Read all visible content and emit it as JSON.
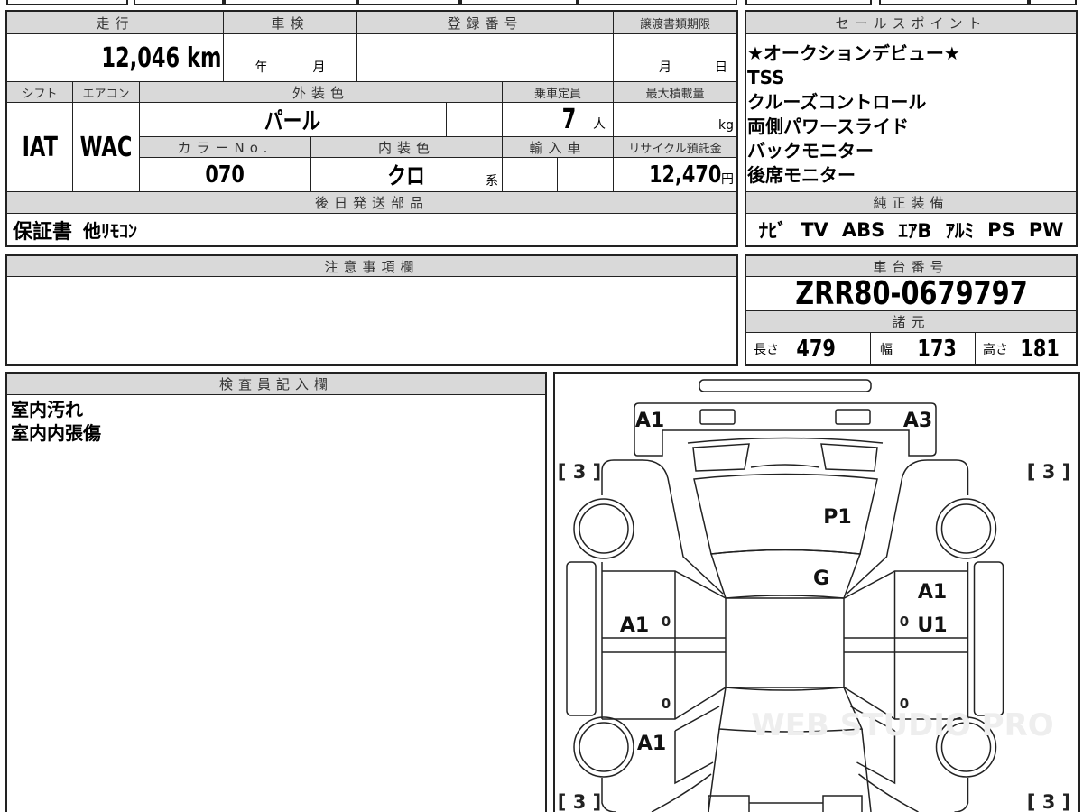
{
  "vehicle": {
    "mileage_header": "走行",
    "mileage": "12,046",
    "mileage_unit": "km",
    "inspection_header": "車検",
    "inspection_year": "年",
    "inspection_month": "月",
    "registration_header": "登録番号",
    "transfer_deadline_header": "譲渡書類期限",
    "transfer_month": "月",
    "transfer_day": "日",
    "shift_header": "シフト",
    "shift": "IAT",
    "ac_header": "エアコン",
    "ac": "WAC",
    "exterior_color_header": "外装色",
    "exterior_color": "パール",
    "capacity_header": "乗車定員",
    "capacity": "7",
    "capacity_unit": "人",
    "max_load_header": "最大積載量",
    "max_load_unit": "kg",
    "color_no_header": "カラーNo.",
    "color_no": "070",
    "interior_color_header": "内装色",
    "interior_color": "クロ",
    "interior_suffix": "系",
    "import_header": "輸入車",
    "recycle_header": "リサイクル預託金",
    "recycle_fee": "12,470",
    "recycle_unit": "円"
  },
  "later_parts": {
    "header": "後日発送部品",
    "items": [
      "保証書",
      "他ﾘﾓｺﾝ"
    ]
  },
  "sales_points": {
    "header": "セールスポイント",
    "items": [
      "★オークションデビュー★",
      "TSS",
      "クルーズコントロール",
      "両側パワースライド",
      "バックモニター",
      "後席モニター"
    ]
  },
  "equipment": {
    "header": "純正装備",
    "items": [
      "ﾅﾋﾞ",
      "TV",
      "ABS",
      "ｴｱB",
      "ｱﾙﾐ",
      "PS",
      "PW"
    ]
  },
  "notes": {
    "header": "注意事項欄"
  },
  "chassis": {
    "header": "車台番号",
    "number": "ZRR80-0679797",
    "specs_header": "諸元",
    "length_label": "長さ",
    "length": "479",
    "width_label": "幅",
    "width": "173",
    "height_label": "高さ",
    "height": "181"
  },
  "inspector": {
    "header": "検査員記入欄",
    "lines": [
      "室内汚れ",
      "室内内張傷"
    ]
  },
  "diagram": {
    "marks": {
      "front_left": "A1",
      "front_right": "A3",
      "hood": "P1",
      "windshield": "G",
      "right_front_door_1": "A1",
      "right_front_door_2": "U1",
      "left_front_door": "A1",
      "left_rear_fender": "A1",
      "door_zero": "0"
    },
    "tread": [
      "[ 3 ]",
      "[ 3 ]",
      "[ 3 ]",
      "[ 3 ]"
    ],
    "watermark": "WEB STUDIO PRO"
  }
}
